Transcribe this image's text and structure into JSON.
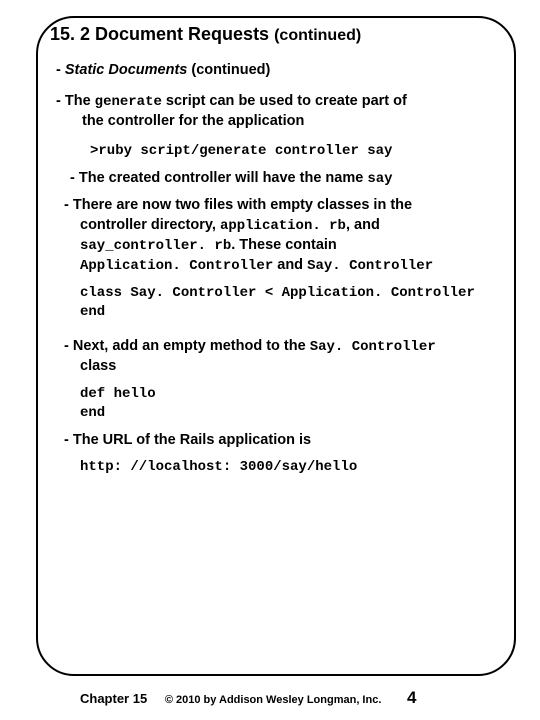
{
  "title_main": "15. 2 Document Requests",
  "title_cont": "(continued)",
  "subheading_dash": "-",
  "subheading_em": "Static Documents",
  "subheading_cont": "(continued)",
  "b1_a": "- The ",
  "b1_code": "generate",
  "b1_b": " script can be used to create part of",
  "b1_c": "the controller for the application",
  "code1": ">ruby script/generate controller say",
  "sb1_a": "- The created controller will have the name ",
  "sb1_code": "say",
  "sb2_a": "- There are now two files with empty classes in the",
  "sb2_b": "controller directory, ",
  "sb2_code1": "application. rb",
  "sb2_c": ", and",
  "sb2_code2": "say_controller. rb",
  "sb2_d": ". These contain",
  "sb2_code3": "Application. Controller",
  "sb2_e": " and ",
  "sb2_code4": "Say. Controller",
  "code2": "class Say. Controller < Application. Controller\nend",
  "sb3_a": "- Next, add an empty method to the ",
  "sb3_code": "Say. Controller",
  "sb3_b": "class",
  "code3": "def hello\nend",
  "sb4": "- The URL of the Rails application is",
  "code4": "http: //localhost: 3000/say/hello",
  "footer_chapter": "Chapter 15",
  "footer_copy": "© 2010 by Addison Wesley Longman, Inc.",
  "footer_page": "4"
}
